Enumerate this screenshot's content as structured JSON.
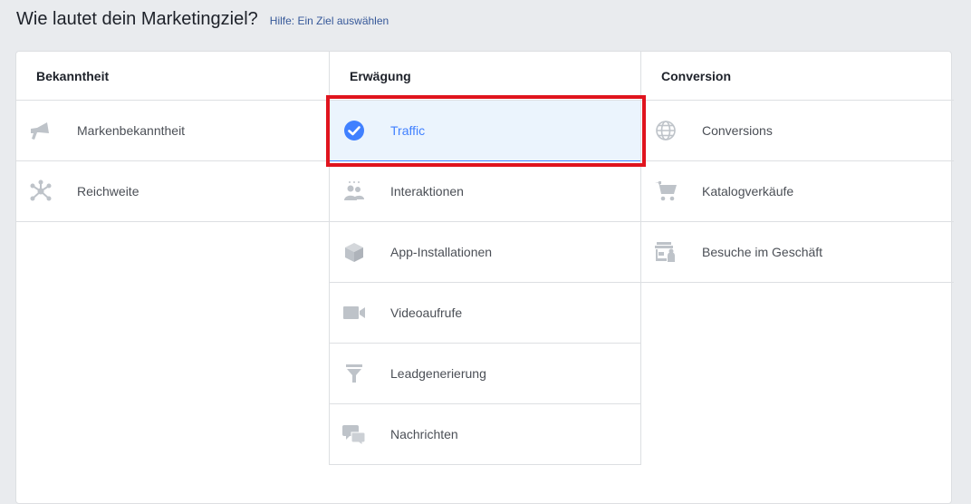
{
  "header": {
    "title": "Wie lautet dein Marketingziel?",
    "help_link": "Hilfe: Ein Ziel auswählen"
  },
  "columns": [
    {
      "title": "Bekanntheit",
      "items": [
        {
          "label": "Markenbekanntheit",
          "icon": "megaphone-icon"
        },
        {
          "label": "Reichweite",
          "icon": "reach-icon"
        }
      ]
    },
    {
      "title": "Erwägung",
      "items": [
        {
          "label": "Traffic",
          "icon": "checkmark-icon",
          "selected": true
        },
        {
          "label": "Interaktionen",
          "icon": "people-icon"
        },
        {
          "label": "App-Installationen",
          "icon": "box-icon"
        },
        {
          "label": "Videoaufrufe",
          "icon": "video-camera-icon"
        },
        {
          "label": "Leadgenerierung",
          "icon": "funnel-icon"
        },
        {
          "label": "Nachrichten",
          "icon": "chat-bubbles-icon"
        }
      ]
    },
    {
      "title": "Conversion",
      "items": [
        {
          "label": "Conversions",
          "icon": "globe-icon"
        },
        {
          "label": "Katalogverkäufe",
          "icon": "shopping-cart-icon"
        },
        {
          "label": "Besuche im Geschäft",
          "icon": "store-icon"
        }
      ]
    }
  ],
  "colors": {
    "icon_gray": "#bec3c9",
    "selected_blue": "#4080ff",
    "selected_bg": "#ebf4fd",
    "highlight_red": "#e0141e"
  }
}
